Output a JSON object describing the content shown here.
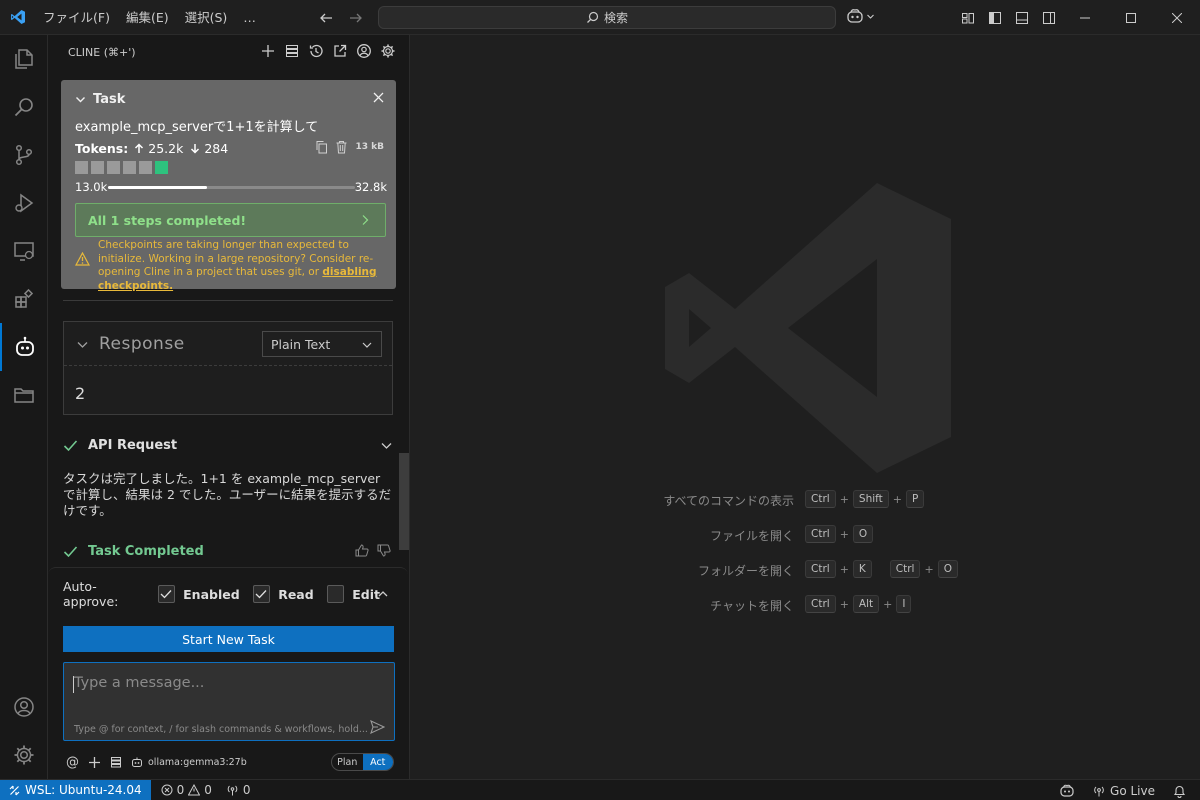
{
  "menu": [
    "ファイル(F)",
    "編集(E)",
    "選択(S)",
    "…"
  ],
  "search": {
    "label": "検索"
  },
  "sidebar": {
    "title": "CLINE (⌘+')"
  },
  "task": {
    "header": "Task",
    "text": "example_mcp_serverで1+1を計算して",
    "tokens_label": "Tokens:",
    "tokens_in": "25.2k",
    "tokens_out": "284",
    "size": "13 kB",
    "context_used": "13.0k",
    "context_max": "32.8k",
    "context_fraction": 0.4,
    "steps": "All 1 steps completed!",
    "warning": "Checkpoints are taking longer than expected to initialize. Working in a large repository? Consider re-opening Cline in a project that uses git, or ",
    "warning_link": "disabling checkpoints."
  },
  "response": {
    "title": "Response",
    "format": "Plain Text",
    "value": "2"
  },
  "api_request": {
    "label": "API Request"
  },
  "result_text": "タスクは完了しました。1+1 を example_mcp_server で計算し、結果は 2 でした。ユーザーに結果を提示するだけです。",
  "completed": {
    "label": "Task Completed"
  },
  "auto_approve": {
    "label": "Auto-approve:",
    "options": [
      {
        "label": "Enabled",
        "checked": true
      },
      {
        "label": "Read",
        "checked": true
      },
      {
        "label": "Edit",
        "checked": false
      }
    ]
  },
  "start_button": "Start New Task",
  "message": {
    "placeholder": "Type a message...",
    "hint": "Type @ for context, / for slash commands & workflows, hold..."
  },
  "model": "ollama:gemma3:27b",
  "mode": {
    "plan": "Plan",
    "act": "Act",
    "active": "Act"
  },
  "shortcuts": [
    {
      "label": "すべてのコマンドの表示",
      "keys": [
        "Ctrl",
        "+",
        "Shift",
        "+",
        "P"
      ]
    },
    {
      "label": "ファイルを開く",
      "keys": [
        "Ctrl",
        "+",
        "O"
      ]
    },
    {
      "label": "フォルダーを開く",
      "keys": [
        "Ctrl",
        "+",
        "K",
        " ",
        "Ctrl",
        "+",
        "O"
      ]
    },
    {
      "label": "チャットを開く",
      "keys": [
        "Ctrl",
        "+",
        "Alt",
        "+",
        "I"
      ]
    }
  ],
  "status": {
    "remote": "WSL: Ubuntu-24.04",
    "errors": "0",
    "warnings": "0",
    "ports": "0",
    "go_live": "Go Live"
  },
  "colors": {
    "accent": "#0e70c0",
    "success": "#73c991",
    "warning": "#e8b93a"
  }
}
